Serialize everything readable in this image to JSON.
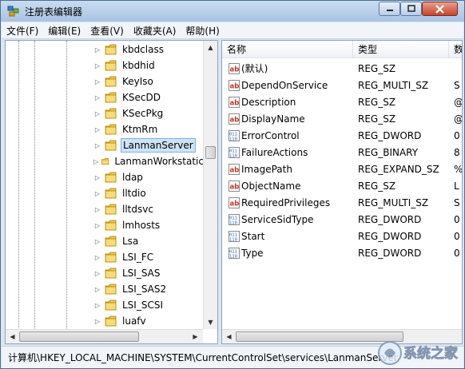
{
  "window": {
    "title": "注册表编辑器"
  },
  "menu": [
    {
      "label": "文件(F)"
    },
    {
      "label": "编辑(E)"
    },
    {
      "label": "查看(V)"
    },
    {
      "label": "收藏夹(A)"
    },
    {
      "label": "帮助(H)"
    }
  ],
  "tree": {
    "items": [
      {
        "label": "kbdclass",
        "expandable": true
      },
      {
        "label": "kbdhid",
        "expandable": true
      },
      {
        "label": "KeyIso",
        "expandable": true
      },
      {
        "label": "KSecDD",
        "expandable": true
      },
      {
        "label": "KSecPkg",
        "expandable": true
      },
      {
        "label": "KtmRm",
        "expandable": true
      },
      {
        "label": "LanmanServer",
        "expandable": true,
        "selected": true
      },
      {
        "label": "LanmanWorkstatic",
        "expandable": true
      },
      {
        "label": "ldap",
        "expandable": true
      },
      {
        "label": "lltdio",
        "expandable": true
      },
      {
        "label": "lltdsvc",
        "expandable": true
      },
      {
        "label": "lmhosts",
        "expandable": true
      },
      {
        "label": "Lsa",
        "expandable": true
      },
      {
        "label": "LSI_FC",
        "expandable": true
      },
      {
        "label": "LSI_SAS",
        "expandable": true
      },
      {
        "label": "LSI_SAS2",
        "expandable": true
      },
      {
        "label": "LSI_SCSI",
        "expandable": true
      },
      {
        "label": "luafv",
        "expandable": true
      }
    ]
  },
  "values": {
    "columns": {
      "name": "名称",
      "type": "类型",
      "data": "数"
    },
    "rows": [
      {
        "icon": "string-value-icon",
        "name": "(默认)",
        "type": "REG_SZ",
        "data": ""
      },
      {
        "icon": "string-value-icon",
        "name": "DependOnService",
        "type": "REG_MULTI_SZ",
        "data": "S"
      },
      {
        "icon": "string-value-icon",
        "name": "Description",
        "type": "REG_SZ",
        "data": "@"
      },
      {
        "icon": "string-value-icon",
        "name": "DisplayName",
        "type": "REG_SZ",
        "data": "@"
      },
      {
        "icon": "binary-value-icon",
        "name": "ErrorControl",
        "type": "REG_DWORD",
        "data": "0"
      },
      {
        "icon": "binary-value-icon",
        "name": "FailureActions",
        "type": "REG_BINARY",
        "data": "8"
      },
      {
        "icon": "string-value-icon",
        "name": "ImagePath",
        "type": "REG_EXPAND_SZ",
        "data": "%"
      },
      {
        "icon": "string-value-icon",
        "name": "ObjectName",
        "type": "REG_SZ",
        "data": "L"
      },
      {
        "icon": "string-value-icon",
        "name": "RequiredPrivileges",
        "type": "REG_MULTI_SZ",
        "data": "S"
      },
      {
        "icon": "binary-value-icon",
        "name": "ServiceSidType",
        "type": "REG_DWORD",
        "data": "0"
      },
      {
        "icon": "binary-value-icon",
        "name": "Start",
        "type": "REG_DWORD",
        "data": "0"
      },
      {
        "icon": "binary-value-icon",
        "name": "Type",
        "type": "REG_DWORD",
        "data": "0"
      }
    ]
  },
  "status": {
    "path": "计算机\\HKEY_LOCAL_MACHINE\\SYSTEM\\CurrentControlSet\\services\\LanmanServer"
  },
  "watermark": {
    "text": "系统之家"
  },
  "colors": {
    "selection": "#cde3f8",
    "string_icon": "#c0392b",
    "binary_icon": "#1f5fbf",
    "folder": "#f2c94c"
  }
}
